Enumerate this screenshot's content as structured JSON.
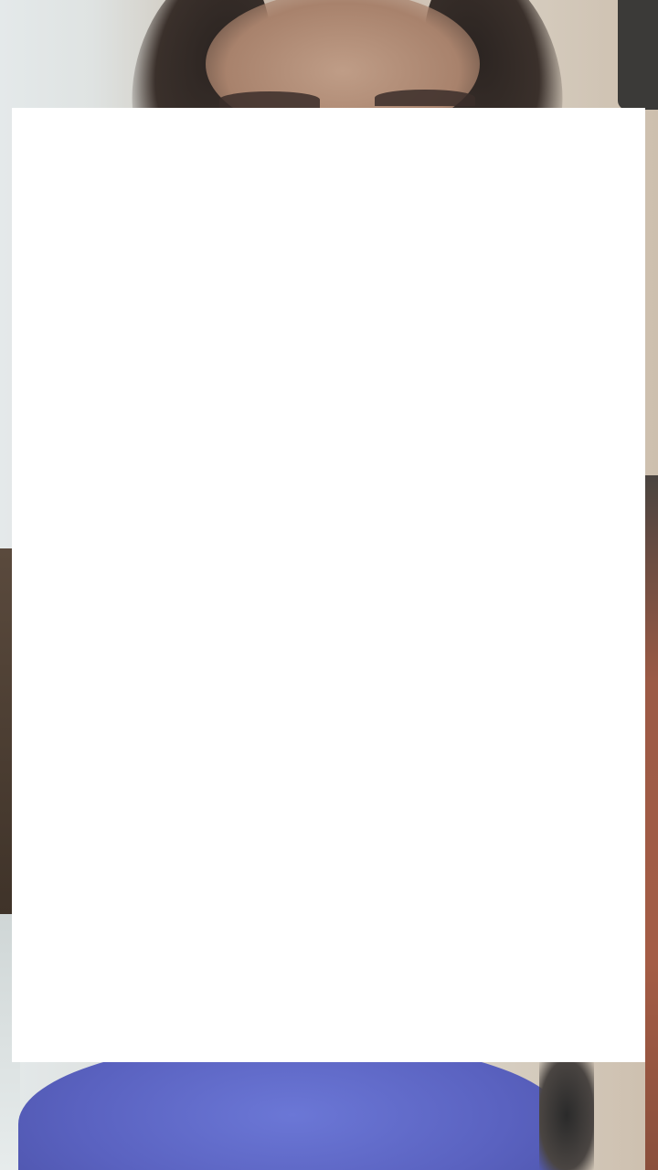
{
  "panel": {
    "background": "#ffffff"
  },
  "video": {
    "shirt_color": "#5a62c0"
  }
}
